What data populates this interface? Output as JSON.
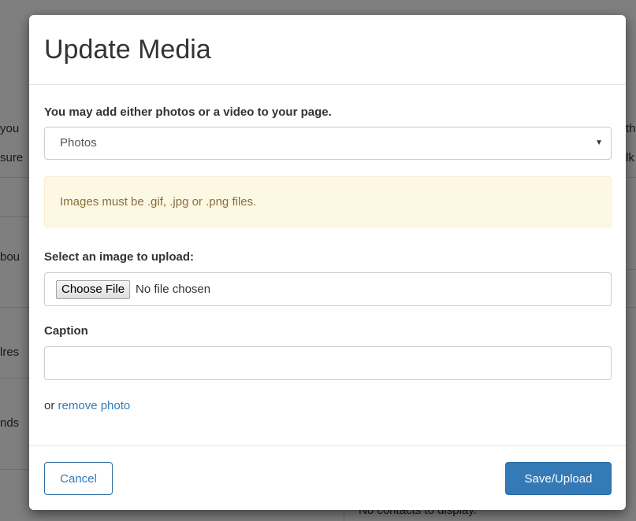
{
  "background": {
    "left_fragments": [
      "you",
      "sure",
      "bou",
      "lres",
      "nds"
    ],
    "right_fragments": [
      "th",
      "lk"
    ],
    "bottom_text": "No contacts to display."
  },
  "modal": {
    "title": "Update Media",
    "media_type_label": "You may add either photos or a video to your page.",
    "media_type_select": {
      "selected": "Photos",
      "arrow_icon": "caret-down-icon"
    },
    "alert_text": "Images must be .gif, .jpg or .png files.",
    "upload_label": "Select an image to upload:",
    "file_input": {
      "button_label": "Choose File",
      "status": "No file chosen"
    },
    "caption_label": "Caption",
    "caption_value": "",
    "remove_prefix": "or",
    "remove_link": "remove photo",
    "cancel_label": "Cancel",
    "save_label": "Save/Upload"
  },
  "colors": {
    "primary": "#337ab7",
    "alert_bg": "#fcf8e3",
    "alert_text": "#8a6d3b"
  }
}
